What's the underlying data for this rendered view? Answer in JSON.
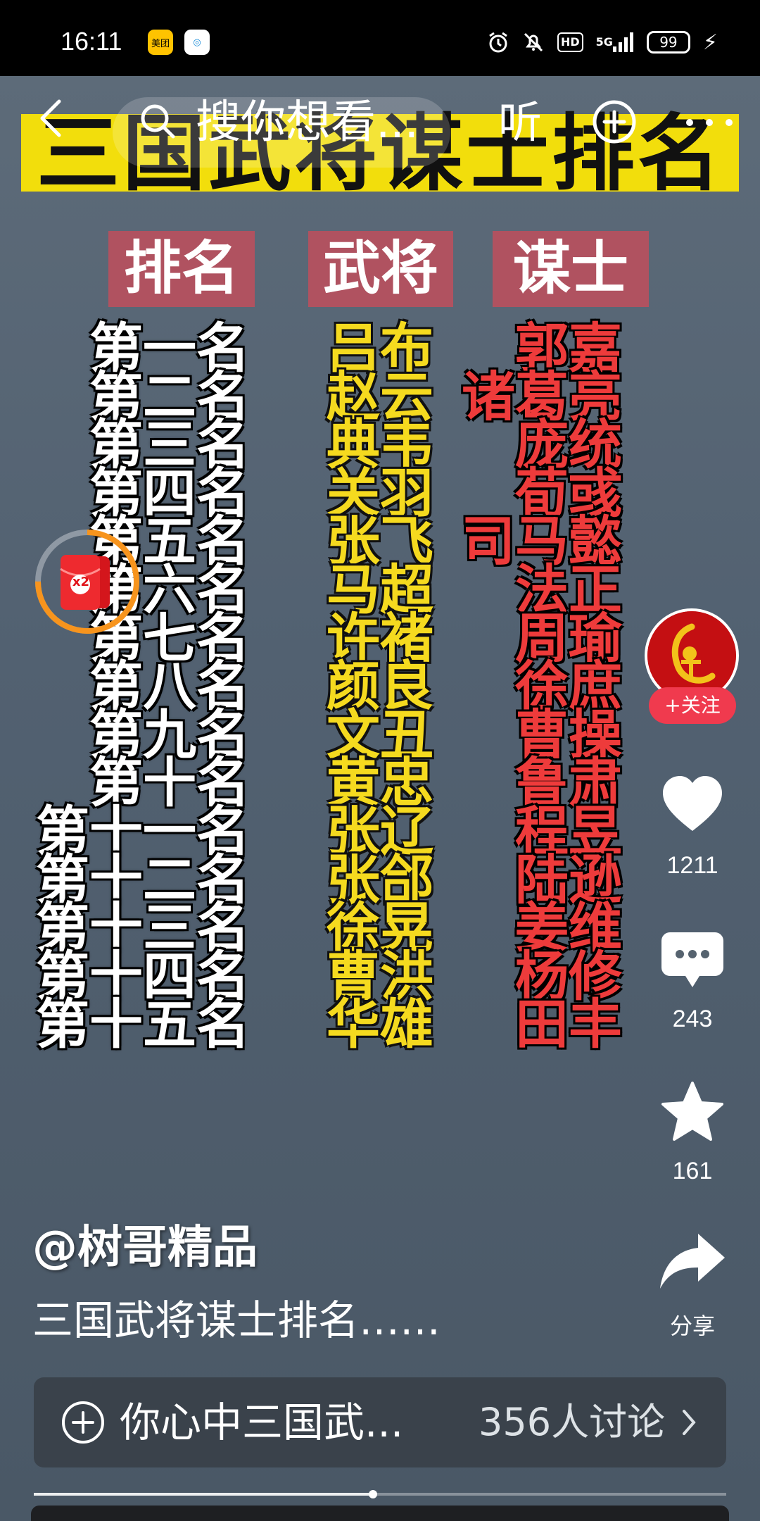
{
  "status_bar": {
    "time": "16:11",
    "apps": [
      "美团",
      "中国移动"
    ],
    "hd": "HD",
    "network": "5G",
    "battery": "99"
  },
  "topnav": {
    "search_placeholder": "搜你想看...",
    "listen_label": "听"
  },
  "poster": {
    "title": "三国武将谋士排名",
    "headers": {
      "rank": "排名",
      "general": "武将",
      "advisor": "谋士"
    },
    "rows": [
      {
        "rank": "第一名",
        "general": "吕布",
        "advisor": "郭嘉"
      },
      {
        "rank": "第二名",
        "general": "赵云",
        "advisor": "诸葛亮"
      },
      {
        "rank": "第三名",
        "general": "典韦",
        "advisor": "庞统"
      },
      {
        "rank": "第四名",
        "general": "关羽",
        "advisor": "荀彧"
      },
      {
        "rank": "第五名",
        "general": "张飞",
        "advisor": "司马懿"
      },
      {
        "rank": "第六名",
        "general": "马超",
        "advisor": "法正"
      },
      {
        "rank": "第七名",
        "general": "许褚",
        "advisor": "周瑜"
      },
      {
        "rank": "第八名",
        "general": "颜良",
        "advisor": "徐庶"
      },
      {
        "rank": "第九名",
        "general": "文丑",
        "advisor": "曹操"
      },
      {
        "rank": "第十名",
        "general": "黄忠",
        "advisor": "鲁肃"
      },
      {
        "rank": "第十一名",
        "general": "张辽",
        "advisor": "程昱"
      },
      {
        "rank": "第十二名",
        "general": "张郃",
        "advisor": "陆逊"
      },
      {
        "rank": "第十三名",
        "general": "徐晃",
        "advisor": "姜维"
      },
      {
        "rank": "第十四名",
        "general": "曹洪",
        "advisor": "杨修"
      },
      {
        "rank": "第十五名",
        "general": "华雄",
        "advisor": "田丰"
      }
    ]
  },
  "red_packet": {
    "multiplier": "x2"
  },
  "rail": {
    "follow_label": "+关注",
    "likes": "1211",
    "comments": "243",
    "favorites": "161",
    "share_label": "分享"
  },
  "caption": {
    "author": "@树哥精品",
    "description": "三国武将谋士排名……"
  },
  "topic": {
    "text": "你心中三国武...",
    "count": "356人讨论"
  },
  "playback": {
    "progress": 0.49
  },
  "colors": {
    "banner": "#f2de0c",
    "header_bg": "#b05260",
    "general_text": "#f5da1f",
    "advisor_text": "#ee3b3b",
    "follow": "#f03a4e",
    "red_packet_ring": "#f7941d"
  }
}
